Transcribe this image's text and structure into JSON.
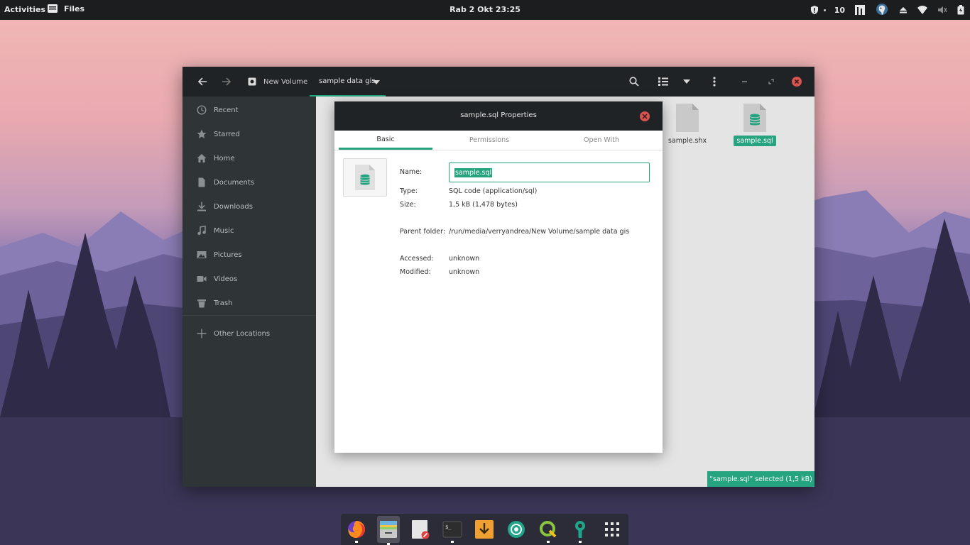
{
  "topbar": {
    "activities": "Activities",
    "app_name": "Files",
    "clock": "Rab  2 Okt  23:25",
    "indicator_count": "10"
  },
  "window": {
    "path": {
      "volume": "New Volume",
      "current": "sample data gis"
    },
    "sidebar": {
      "items": [
        {
          "label": "Recent",
          "icon": "clock-icon"
        },
        {
          "label": "Starred",
          "icon": "star-icon"
        },
        {
          "label": "Home",
          "icon": "home-icon"
        },
        {
          "label": "Documents",
          "icon": "document-icon"
        },
        {
          "label": "Downloads",
          "icon": "download-icon"
        },
        {
          "label": "Music",
          "icon": "music-icon"
        },
        {
          "label": "Pictures",
          "icon": "picture-icon"
        },
        {
          "label": "Videos",
          "icon": "video-icon"
        },
        {
          "label": "Trash",
          "icon": "trash-icon"
        }
      ],
      "other_locations": "Other Locations"
    },
    "files": [
      {
        "name": "sample.shx",
        "selected": false
      },
      {
        "name": "sample.sql",
        "selected": true
      }
    ],
    "status": "“sample.sql” selected  (1,5 kB)"
  },
  "dialog": {
    "title": "sample.sql Properties",
    "tabs": [
      "Basic",
      "Permissions",
      "Open With"
    ],
    "active_tab": "Basic",
    "name_label": "Name:",
    "name_value": "sample.sql",
    "type_label": "Type:",
    "type_value": "SQL code (application/sql)",
    "size_label": "Size:",
    "size_value": "1,5 kB (1,478 bytes)",
    "parent_label": "Parent folder:",
    "parent_value": "/run/media/verryandrea/New Volume/sample data gis",
    "accessed_label": "Accessed:",
    "accessed_value": "unknown",
    "modified_label": "Modified:",
    "modified_value": "unknown"
  },
  "dock": {
    "apps": [
      "firefox-icon",
      "archive-manager-icon",
      "text-editor-icon",
      "terminal-icon",
      "downloader-icon",
      "shutter-icon",
      "qgis-icon",
      "settings-tool-icon",
      "app-grid-icon"
    ]
  },
  "colors": {
    "accent": "#26a37f",
    "headerbar": "#1f2325",
    "sidebar": "#2f3436",
    "close_red": "#d9534f"
  }
}
